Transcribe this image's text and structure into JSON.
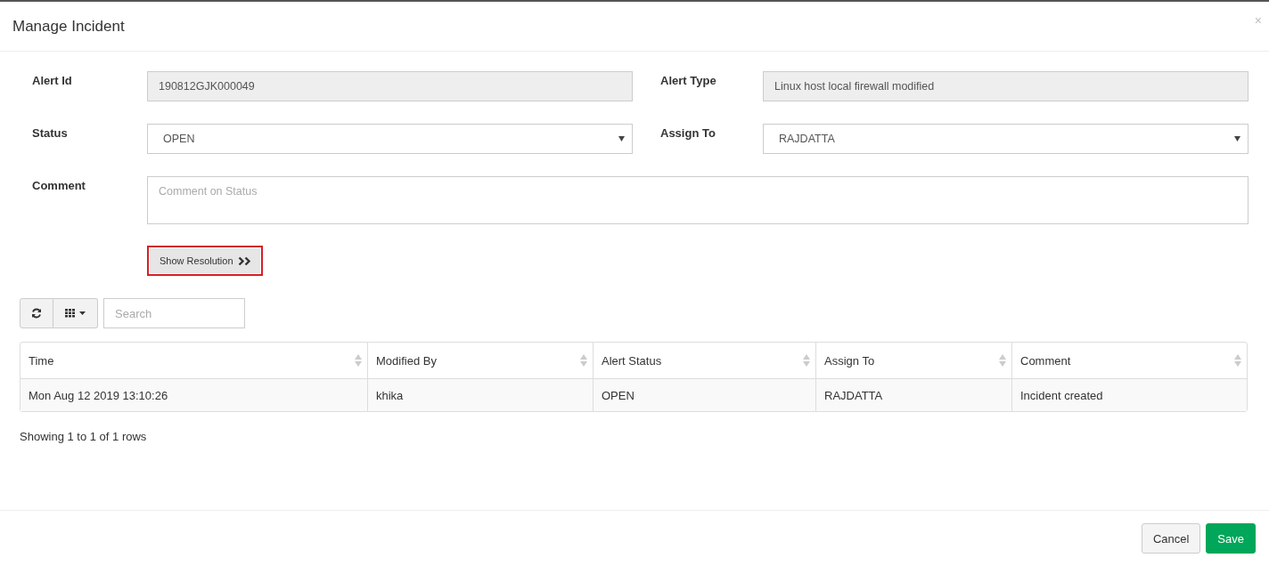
{
  "dialog": {
    "title": "Manage Incident",
    "close": "×"
  },
  "form": {
    "alert_id": {
      "label": "Alert Id",
      "value": "190812GJK000049"
    },
    "alert_type": {
      "label": "Alert Type",
      "value": "Linux host local firewall modified"
    },
    "status": {
      "label": "Status",
      "value": "OPEN"
    },
    "assign_to": {
      "label": "Assign To",
      "value": "RAJDATTA"
    },
    "comment": {
      "label": "Comment",
      "placeholder": "Comment on Status"
    },
    "show_resolution": {
      "label": "Show Resolution",
      "highlighted": true
    }
  },
  "toolbar": {
    "search": {
      "placeholder": "Search"
    }
  },
  "table": {
    "columns": [
      "Time",
      "Modified By",
      "Alert Status",
      "Assign To",
      "Comment"
    ],
    "rows": [
      [
        "Mon Aug 12 2019 13:10:26",
        "khika",
        "OPEN",
        "RAJDATTA",
        "Incident created"
      ]
    ]
  },
  "pagination": "Showing 1 to 1 of 1 rows",
  "buttons": {
    "cancel": "Cancel",
    "save": "Save"
  }
}
